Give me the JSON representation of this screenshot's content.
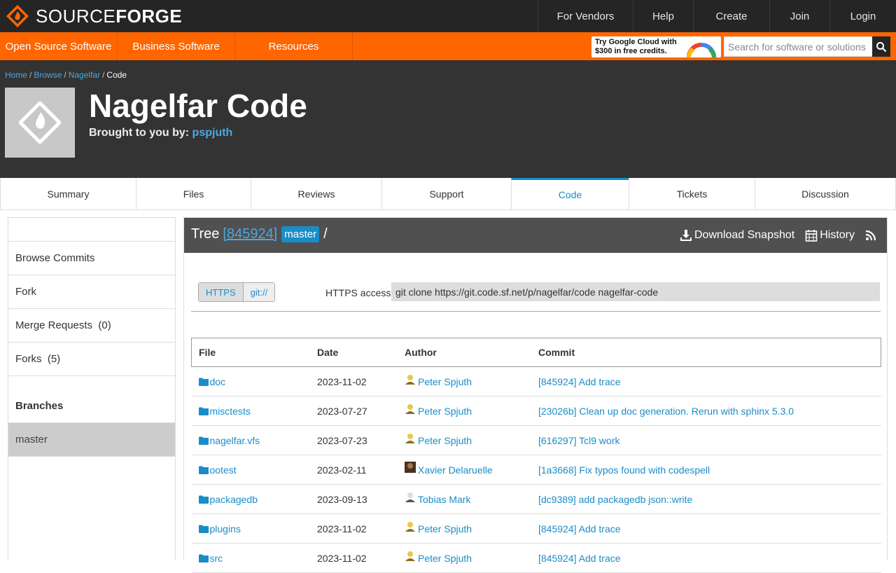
{
  "brand": {
    "word_thin": "SOURCE",
    "word_bold": "FORGE",
    "icon": "sourceforge-logo-icon",
    "accent": "#ff6600"
  },
  "topnav": [
    "For Vendors",
    "Help",
    "Create",
    "Join",
    "Login"
  ],
  "orangenav": [
    "Open Source Software",
    "Business Software",
    "Resources"
  ],
  "ad": {
    "line1": "Try Google Cloud with",
    "line2": "$300 in free credits."
  },
  "search": {
    "placeholder": "Search for software or solutions"
  },
  "breadcrumb": {
    "items": [
      "Home",
      "Browse",
      "Nagelfar"
    ],
    "current": "Code"
  },
  "project": {
    "title": "Nagelfar Code",
    "brought_label": "Brought to you by:",
    "author": "pspjuth"
  },
  "tabs": [
    "Summary",
    "Files",
    "Reviews",
    "Support",
    "Code",
    "Tickets",
    "Discussion"
  ],
  "active_tab": "Code",
  "sidebar": {
    "items": [
      "Browse Commits",
      "Fork",
      "Merge Requests  (0)",
      "Forks  (5)"
    ],
    "branches_heading": "Branches",
    "branches": [
      "master"
    ]
  },
  "tree": {
    "label": "Tree",
    "commit": "[845924]",
    "branch": "master",
    "slash": "/",
    "download_label": "Download Snapshot",
    "history_label": "History"
  },
  "clone": {
    "options": [
      "HTTPS",
      "git://"
    ],
    "access_label": "HTTPS access",
    "command": "git clone https://git.code.sf.net/p/nagelfar/code nagelfar-code"
  },
  "table": {
    "headers": [
      "File",
      "Date",
      "Author",
      "Commit"
    ],
    "rows": [
      {
        "file": "doc",
        "date": "2023-11-02",
        "author": "Peter Spjuth",
        "commit": "[845924] Add trace"
      },
      {
        "file": "misctests",
        "date": "2023-07-27",
        "author": "Peter Spjuth",
        "commit": "[23026b] Clean up doc generation. Rerun with sphinx 5.3.0"
      },
      {
        "file": "nagelfar.vfs",
        "date": "2023-07-23",
        "author": "Peter Spjuth",
        "commit": "[616297] Tcl9 work"
      },
      {
        "file": "ootest",
        "date": "2023-02-11",
        "author": "Xavier Delaruelle",
        "commit": "[1a3668] Fix typos found with codespell"
      },
      {
        "file": "packagedb",
        "date": "2023-09-13",
        "author": "Tobias Mark",
        "commit": "[dc9389] add packagedb json::write"
      },
      {
        "file": "plugins",
        "date": "2023-11-02",
        "author": "Peter Spjuth",
        "commit": "[845924] Add trace"
      },
      {
        "file": "src",
        "date": "2023-11-02",
        "author": "Peter Spjuth",
        "commit": "[845924] Add trace"
      }
    ]
  }
}
